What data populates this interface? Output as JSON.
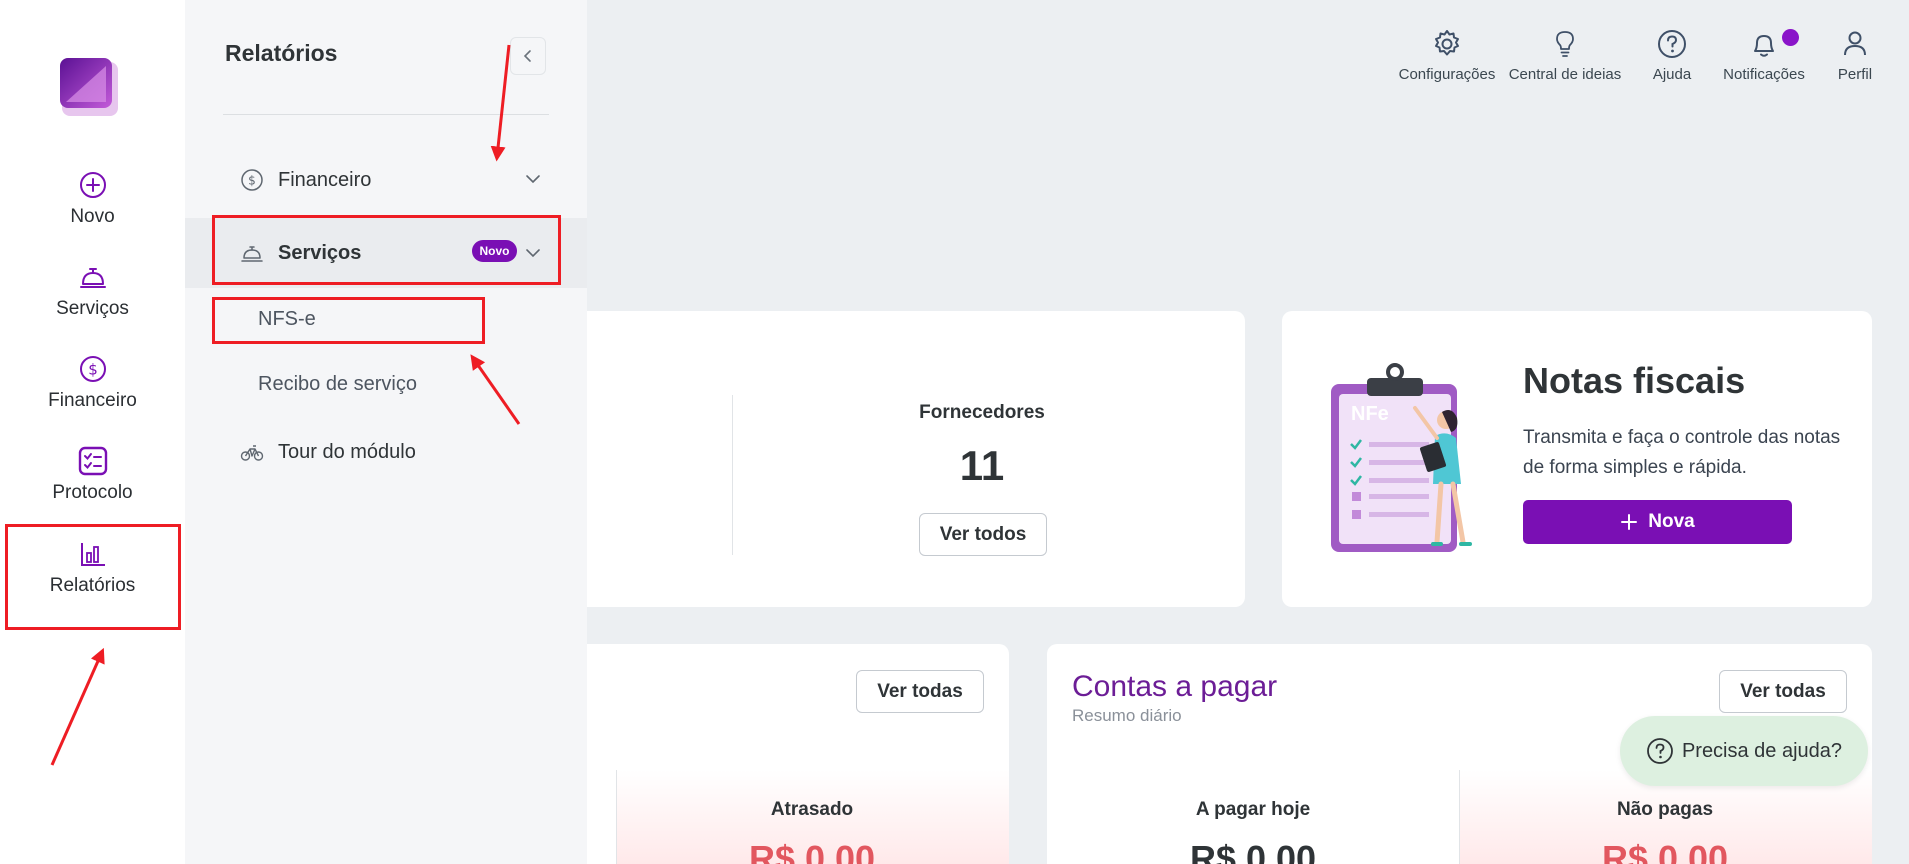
{
  "rail": {
    "items": [
      {
        "label": "Novo",
        "icon": "plus-circle-icon"
      },
      {
        "label": "Serviços",
        "icon": "service-bell-icon"
      },
      {
        "label": "Financeiro",
        "icon": "dollar-circle-icon"
      },
      {
        "label": "Protocolo",
        "icon": "checklist-icon"
      },
      {
        "label": "Relatórios",
        "icon": "bar-chart-icon"
      }
    ]
  },
  "panel": {
    "title": "Relatórios",
    "menu": [
      {
        "label": "Financeiro",
        "icon": "dollar-circle-icon"
      },
      {
        "label": "Serviços",
        "icon": "service-bell-icon",
        "badge": "Novo"
      },
      {
        "label": "Tour do módulo",
        "icon": "bicycle-icon"
      }
    ],
    "sub_items": [
      "NFS-e",
      "Recibo de serviço"
    ]
  },
  "header": {
    "items": [
      {
        "label": "Configurações",
        "icon": "gear-icon"
      },
      {
        "label": "Central de ideias",
        "icon": "lightbulb-icon"
      },
      {
        "label": "Ajuda",
        "icon": "question-circle-icon"
      },
      {
        "label": "Notificações",
        "icon": "bell-icon"
      },
      {
        "label": "Perfil",
        "icon": "user-icon"
      }
    ]
  },
  "fornecedores": {
    "label": "Fornecedores",
    "value": "11",
    "button": "Ver todos"
  },
  "notas": {
    "illustration_text": "NFe",
    "title": "Notas fiscais",
    "description": "Transmita e faça o controle das notas de forma simples e rápida.",
    "button": "Nova"
  },
  "receber": {
    "button": "Ver todas",
    "atrasado_label": "Atrasado",
    "atrasado_value": "R$ 0,00"
  },
  "pagar": {
    "title": "Contas a pagar",
    "subtitle": "Resumo diário",
    "button": "Ver todas",
    "hoje_label": "A pagar hoje",
    "hoje_value": "R$ 0,00",
    "nao_pagas_label": "Não pagas",
    "nao_pagas_value": "R$ 0,00"
  },
  "help": {
    "label": "Precisa de ajuda?"
  },
  "colors": {
    "accent": "#7a0fb4",
    "annotation": "#ee1d24",
    "overdue": "#e2575f"
  }
}
